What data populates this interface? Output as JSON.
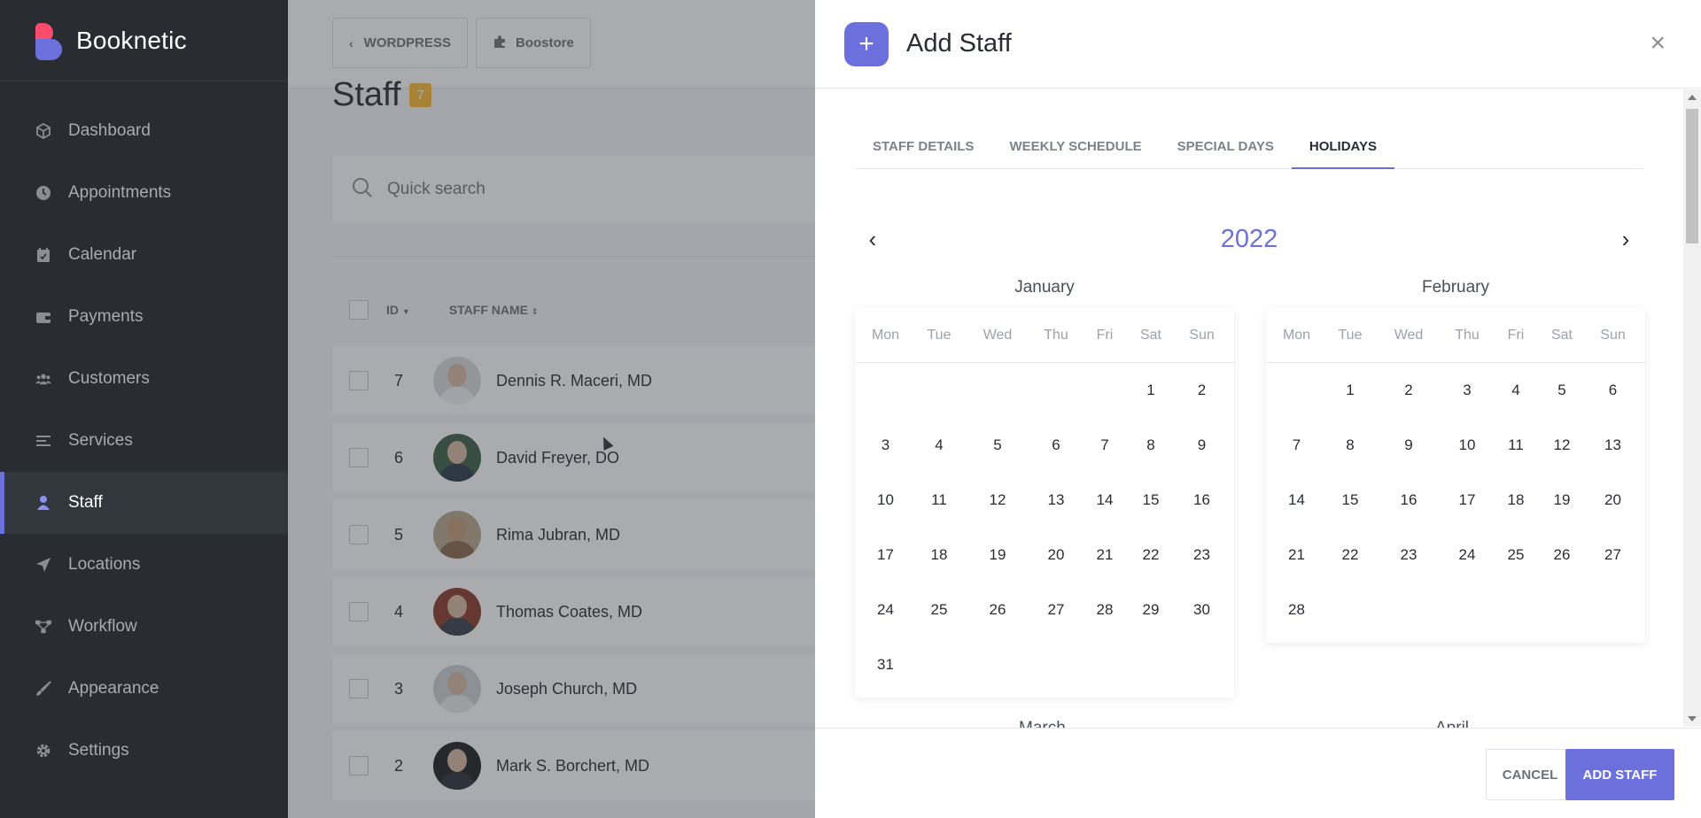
{
  "brand": {
    "name": "Booknetic"
  },
  "sidebar": {
    "items": [
      {
        "label": "Dashboard",
        "icon": "cube-icon"
      },
      {
        "label": "Appointments",
        "icon": "clock-icon"
      },
      {
        "label": "Calendar",
        "icon": "calendar-icon"
      },
      {
        "label": "Payments",
        "icon": "wallet-icon"
      },
      {
        "label": "Customers",
        "icon": "users-icon"
      },
      {
        "label": "Services",
        "icon": "list-icon"
      },
      {
        "label": "Staff",
        "icon": "user-icon",
        "active": true
      },
      {
        "label": "Locations",
        "icon": "location-arrow-icon"
      },
      {
        "label": "Workflow",
        "icon": "workflow-icon"
      },
      {
        "label": "Appearance",
        "icon": "brush-icon"
      },
      {
        "label": "Settings",
        "icon": "gear-icon"
      }
    ]
  },
  "topbar": {
    "wordpress_label": "WORDPRESS",
    "boostore_label": "Boostore"
  },
  "page": {
    "title": "Staff",
    "count": "7"
  },
  "search": {
    "placeholder": "Quick search"
  },
  "table": {
    "headers": {
      "id": "ID",
      "name": "STAFF NAME"
    },
    "rows": [
      {
        "id": "7",
        "name": "Dennis R. Maceri, MD"
      },
      {
        "id": "6",
        "name": "David Freyer, DO"
      },
      {
        "id": "5",
        "name": "Rima Jubran, MD"
      },
      {
        "id": "4",
        "name": "Thomas Coates, MD"
      },
      {
        "id": "3",
        "name": "Joseph Church, MD"
      },
      {
        "id": "2",
        "name": "Mark S. Borchert, MD"
      }
    ]
  },
  "modal": {
    "title": "Add Staff",
    "tabs": [
      "STAFF DETAILS",
      "WEEKLY SCHEDULE",
      "SPECIAL DAYS",
      "HOLIDAYS"
    ],
    "active_tab": "HOLIDAYS",
    "year": "2022",
    "weekdays": [
      "Mon",
      "Tue",
      "Wed",
      "Thu",
      "Fri",
      "Sat",
      "Sun"
    ],
    "months": [
      {
        "name": "January",
        "weeks": [
          [
            "",
            "",
            "",
            "",
            "",
            "1",
            "2"
          ],
          [
            "3",
            "4",
            "5",
            "6",
            "7",
            "8",
            "9"
          ],
          [
            "10",
            "11",
            "12",
            "13",
            "14",
            "15",
            "16"
          ],
          [
            "17",
            "18",
            "19",
            "20",
            "21",
            "22",
            "23"
          ],
          [
            "24",
            "25",
            "26",
            "27",
            "28",
            "29",
            "30"
          ],
          [
            "31",
            "",
            "",
            "",
            "",
            "",
            ""
          ]
        ]
      },
      {
        "name": "February",
        "weeks": [
          [
            "",
            "1",
            "2",
            "3",
            "4",
            "5",
            "6"
          ],
          [
            "7",
            "8",
            "9",
            "10",
            "11",
            "12",
            "13"
          ],
          [
            "14",
            "15",
            "16",
            "17",
            "18",
            "19",
            "20"
          ],
          [
            "21",
            "22",
            "23",
            "24",
            "25",
            "26",
            "27"
          ],
          [
            "28",
            "",
            "",
            "",
            "",
            "",
            ""
          ]
        ]
      }
    ],
    "next_months": [
      "March",
      "April"
    ],
    "cancel_label": "CANCEL",
    "add_label": "ADD STAFF"
  },
  "colors": {
    "accent": "#6c70dc",
    "sidebar": "#292d32",
    "badge": "#fbb833"
  }
}
